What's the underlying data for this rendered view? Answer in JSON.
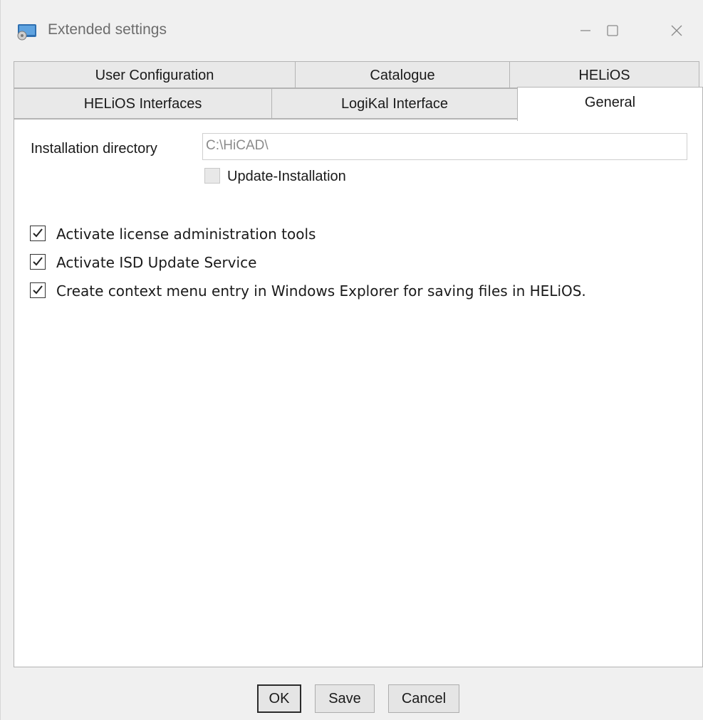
{
  "window": {
    "title": "Extended settings",
    "icons": {
      "app": "hicad-app-icon",
      "minimize": "minimize-icon",
      "maximize": "maximize-icon",
      "close": "close-icon"
    }
  },
  "tabs": {
    "row1": [
      {
        "label": "User Configuration"
      },
      {
        "label": "Catalogue"
      },
      {
        "label": "HELiOS"
      }
    ],
    "row2": [
      {
        "label": "HELiOS Interfaces"
      },
      {
        "label": "LogiKal Interface"
      },
      {
        "label": "General",
        "active": true
      }
    ]
  },
  "general": {
    "install_dir_label": "Installation directory",
    "install_dir_value": "C:\\HiCAD\\",
    "update_installation": {
      "label": "Update-Installation",
      "checked": false,
      "enabled": false
    },
    "options": [
      {
        "label": "Activate license administration tools",
        "checked": true
      },
      {
        "label": "Activate ISD Update Service",
        "checked": true
      },
      {
        "label": "Create context menu entry in Windows Explorer for saving files in HELiOS.",
        "checked": true
      }
    ]
  },
  "buttons": {
    "ok": "OK",
    "save": "Save",
    "cancel": "Cancel"
  },
  "colors": {
    "window_bg": "#f0f0f0",
    "panel_bg": "#ffffff",
    "tab_bg": "#e9e9e9",
    "border": "#b4b4b4"
  }
}
